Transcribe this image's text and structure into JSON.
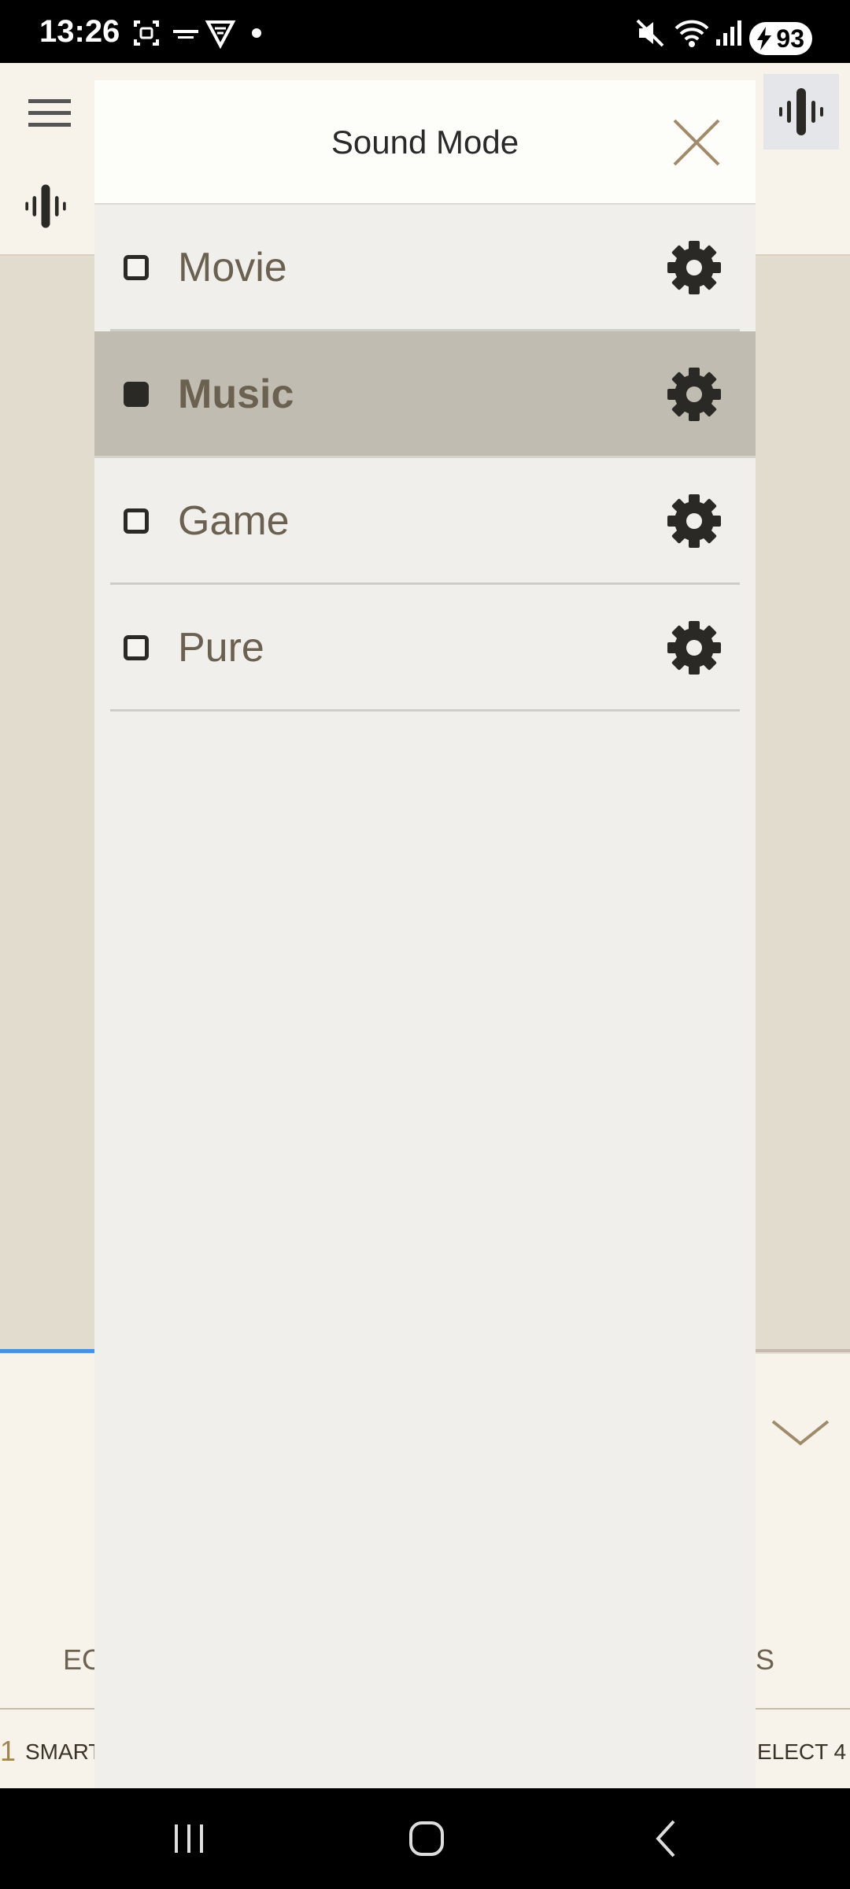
{
  "status_bar": {
    "time": "13:26",
    "battery": "93",
    "icons": [
      "screenshot-icon",
      "notification-icon",
      "vpn-icon",
      "dot-icon",
      "mute-icon",
      "wifi-icon",
      "signal-icon",
      "battery-icon"
    ]
  },
  "background_app": {
    "bottom_left_text": "EC",
    "bottom_right_text": "S",
    "input_left_number": "1",
    "input_left_label": "SMART",
    "input_right_label": "ELECT 4"
  },
  "modal": {
    "title": "Sound Mode",
    "modes": [
      {
        "label": "Movie",
        "selected": false
      },
      {
        "label": "Music",
        "selected": true
      },
      {
        "label": "Game",
        "selected": false
      },
      {
        "label": "Pure",
        "selected": false
      }
    ]
  },
  "colors": {
    "selected_row": "#c1bcb1",
    "label_text": "#6b6150",
    "accent_blue": "#4a90e2"
  }
}
